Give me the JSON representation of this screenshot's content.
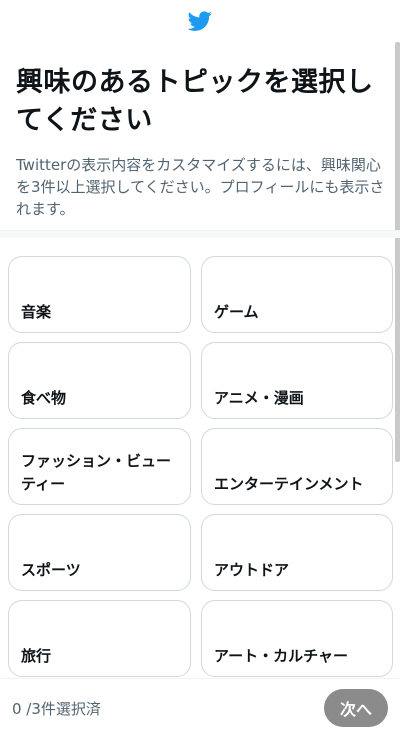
{
  "header": {
    "title": "興味のあるトピックを選択してください",
    "description": "Twitterの表示内容をカスタマイズするには、興味関心を3件以上選択してください。プロフィールにも表示されます。",
    "logo_icon": "twitter-bird-icon",
    "brand_color": "#1d9bf0"
  },
  "topics": [
    {
      "label": "音楽"
    },
    {
      "label": "ゲーム"
    },
    {
      "label": "食べ物"
    },
    {
      "label": "アニメ・漫画"
    },
    {
      "label": "ファッション・ビューティー"
    },
    {
      "label": "エンターテインメント"
    },
    {
      "label": "スポーツ"
    },
    {
      "label": "アウトドア"
    },
    {
      "label": "旅行"
    },
    {
      "label": "アート・カルチャー"
    }
  ],
  "footer": {
    "selected_count": "0 /3件選択済",
    "next_label": "次へ"
  }
}
